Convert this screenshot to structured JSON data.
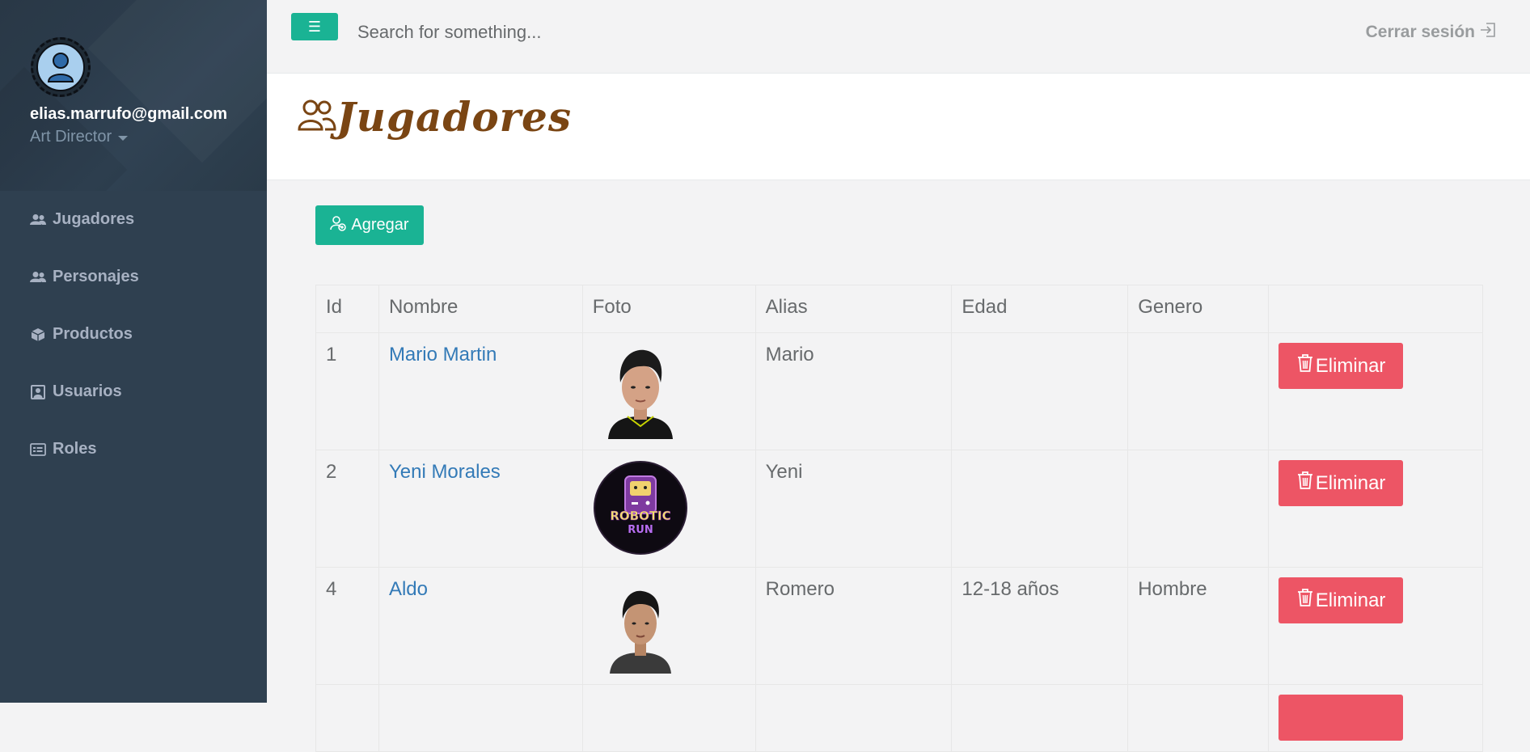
{
  "user": {
    "email": "elias.marrufo@gmail.com",
    "role": "Art Director"
  },
  "nav": {
    "items": [
      {
        "label": "Jugadores",
        "icon": "users-icon"
      },
      {
        "label": "Personajes",
        "icon": "users-icon"
      },
      {
        "label": "Productos",
        "icon": "cube-icon"
      },
      {
        "label": "Usuarios",
        "icon": "user-box-icon"
      },
      {
        "label": "Roles",
        "icon": "id-card-icon"
      }
    ]
  },
  "topbar": {
    "menu_icon": "☰",
    "search_placeholder": "Search for something...",
    "logout_label": "Cerrar sesión"
  },
  "page": {
    "title": "Jugadores",
    "add_label": "Agregar"
  },
  "table": {
    "headers": [
      "Id",
      "Nombre",
      "Foto",
      "Alias",
      "Edad",
      "Genero",
      ""
    ],
    "delete_label": "Eliminar",
    "rows": [
      {
        "id": "1",
        "nombre": "Mario Martin",
        "foto": "male-portrait",
        "alias": "Mario",
        "edad": "",
        "genero": ""
      },
      {
        "id": "2",
        "nombre": "Yeni Morales",
        "foto": "robotic-run-logo",
        "alias": "Yeni",
        "edad": "",
        "genero": ""
      },
      {
        "id": "4",
        "nombre": "Aldo",
        "foto": "male-portrait",
        "alias": "Romero",
        "edad": "12-18 años",
        "genero": "Hombre"
      }
    ]
  },
  "photo_text": {
    "line1": "ROBOTIC",
    "line2": "RUN"
  },
  "colors": {
    "sidebar": "#2f4050",
    "primary": "#1ab394",
    "danger": "#ed5565",
    "link": "#337ab7",
    "title": "#7a4513"
  }
}
